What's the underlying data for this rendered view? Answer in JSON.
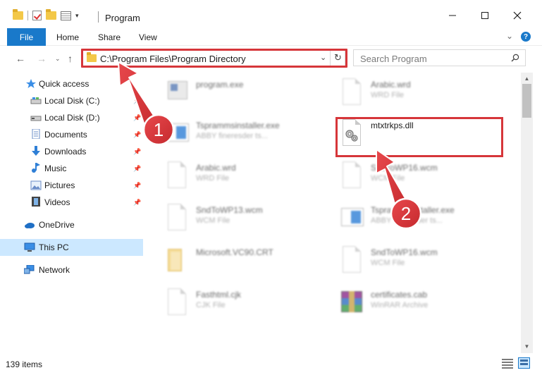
{
  "window": {
    "title": "Program",
    "minimize_icon": "minimize-icon",
    "maximize_icon": "maximize-icon",
    "close_icon": "close-icon"
  },
  "ribbon": {
    "tabs": [
      {
        "label": "File"
      },
      {
        "label": "Home"
      },
      {
        "label": "Share"
      },
      {
        "label": "View"
      }
    ],
    "help_label": "?"
  },
  "address_bar": {
    "path": "C:\\Program Files\\Program Directory"
  },
  "search": {
    "placeholder": "Search Program"
  },
  "sidebar": {
    "items": [
      {
        "label": "Quick access",
        "icon": "star-icon"
      },
      {
        "label": "Local Disk (C:)",
        "icon": "drive-icon",
        "pinned": true
      },
      {
        "label": "Local Disk (D:)",
        "icon": "drive-icon",
        "pinned": true
      },
      {
        "label": "Documents",
        "icon": "documents-icon",
        "pinned": true
      },
      {
        "label": "Downloads",
        "icon": "downloads-icon",
        "pinned": true
      },
      {
        "label": "Music",
        "icon": "music-icon",
        "pinned": true
      },
      {
        "label": "Pictures",
        "icon": "pictures-icon",
        "pinned": true
      },
      {
        "label": "Videos",
        "icon": "videos-icon",
        "pinned": true
      },
      {
        "label": "OneDrive",
        "icon": "cloud-icon"
      },
      {
        "label": "This PC",
        "icon": "computer-icon",
        "selected": true
      },
      {
        "label": "Network",
        "icon": "network-icon"
      }
    ]
  },
  "files": [
    {
      "name": "program.exe",
      "sub": "",
      "icon": "exe-icon"
    },
    {
      "name": "Arabic.wrd",
      "sub": "WRD File",
      "icon": "document-icon"
    },
    {
      "name": "Tsprammsinstaller.exe",
      "sub": "ABBY fineresder ts...",
      "icon": "installer-icon"
    },
    {
      "name": "mtxtrkps.dll",
      "sub": "",
      "icon": "dll-gear-icon"
    },
    {
      "name": "Arabic.wrd",
      "sub": "WRD File",
      "icon": "document-icon"
    },
    {
      "name": "SndToWP16.wcm",
      "sub": "WCM File",
      "icon": "document-icon"
    },
    {
      "name": "SndToWP13.wcm",
      "sub": "WCM File",
      "icon": "document-icon"
    },
    {
      "name": "Tsprammsinstaller.exe",
      "sub": "ABBY fineresder ts...",
      "icon": "installer-icon"
    },
    {
      "name": "Microsoft.VC90.CRT",
      "sub": "",
      "icon": "folder-icon"
    },
    {
      "name": "SndToWP16.wcm",
      "sub": "WCM File",
      "icon": "document-icon"
    },
    {
      "name": "Fasthtml.cjk",
      "sub": "CJK File",
      "icon": "document-icon"
    },
    {
      "name": "certificates.cab",
      "sub": "WinRAR Archive",
      "icon": "winrar-icon"
    }
  ],
  "status": {
    "item_count": "139 items"
  },
  "annotations": [
    {
      "label": "1"
    },
    {
      "label": "2"
    }
  ],
  "colors": {
    "accent": "#1979ca",
    "highlight_red": "#d6363a",
    "selection": "#cce8ff"
  }
}
